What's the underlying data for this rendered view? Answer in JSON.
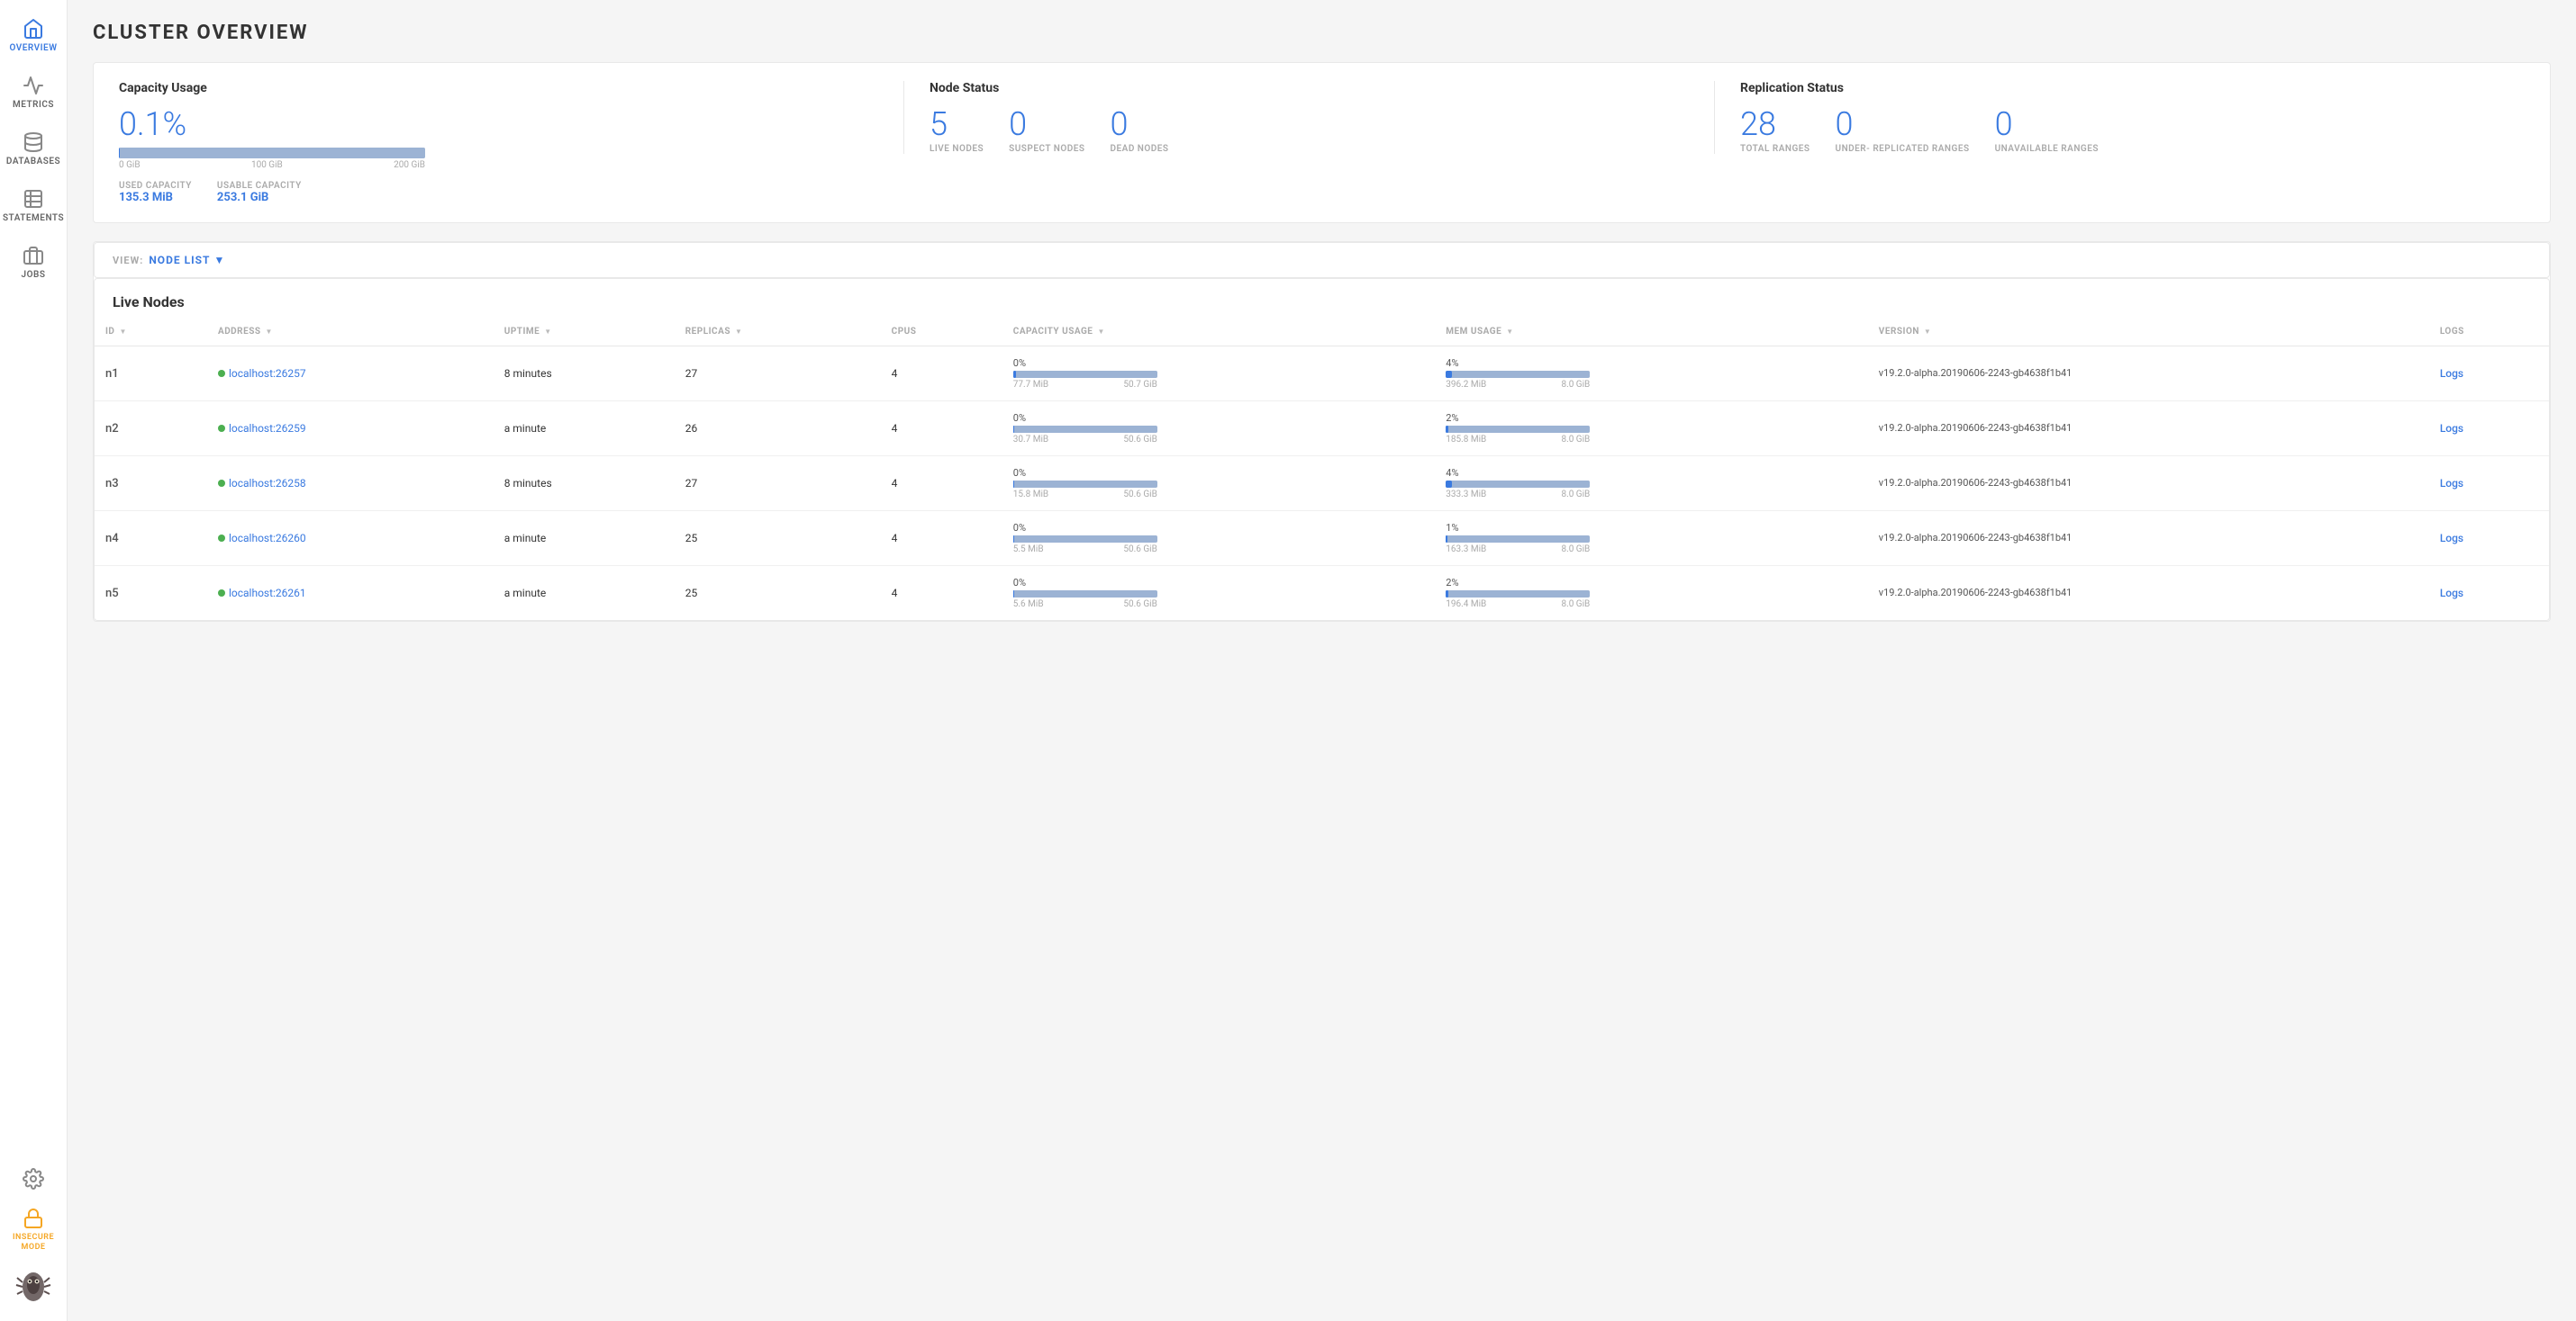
{
  "page": {
    "title": "CLUSTER OVERVIEW"
  },
  "sidebar": {
    "items": [
      {
        "id": "overview",
        "label": "OVERVIEW",
        "active": true
      },
      {
        "id": "metrics",
        "label": "METRICS",
        "active": false
      },
      {
        "id": "databases",
        "label": "DATABASES",
        "active": false
      },
      {
        "id": "statements",
        "label": "STATEMENTS",
        "active": false
      },
      {
        "id": "jobs",
        "label": "JOBS",
        "active": false
      },
      {
        "id": "settings",
        "label": "",
        "active": false
      },
      {
        "id": "insecure",
        "label": "INSECURE MODE",
        "active": false
      }
    ]
  },
  "summary": {
    "capacity_usage": {
      "title": "Capacity Usage",
      "percentage": "0.1%",
      "bar_labels": [
        "0 GiB",
        "100 GiB",
        "200 GiB"
      ],
      "used_label": "USED CAPACITY",
      "used_value": "135.3 MiB",
      "usable_label": "USABLE CAPACITY",
      "usable_value": "253.1 GiB"
    },
    "node_status": {
      "title": "Node Status",
      "live": "5",
      "live_label": "LIVE NODES",
      "suspect": "0",
      "suspect_label": "SUSPECT NODES",
      "dead": "0",
      "dead_label": "DEAD NODES"
    },
    "replication_status": {
      "title": "Replication Status",
      "total": "28",
      "total_label": "TOTAL RANGES",
      "under_replicated": "0",
      "under_replicated_label": "UNDER- REPLICATED RANGES",
      "unavailable": "0",
      "unavailable_label": "UNAVAILABLE RANGES"
    }
  },
  "view": {
    "label": "VIEW:",
    "selected": "NODE LIST"
  },
  "live_nodes": {
    "title": "Live Nodes",
    "columns": {
      "id": "ID",
      "address": "ADDRESS",
      "uptime": "UPTIME",
      "replicas": "REPLICAS",
      "cpus": "CPUS",
      "capacity_usage": "CAPACITY USAGE",
      "mem_usage": "MEM USAGE",
      "version": "VERSION",
      "logs": "LOGS"
    },
    "rows": [
      {
        "id": "n1",
        "address": "localhost:26257",
        "uptime": "8 minutes",
        "replicas": "27",
        "cpus": "4",
        "cap_pct": "0%",
        "cap_used": "77.7 MiB",
        "cap_total": "50.7 GiB",
        "cap_fill_pct": 2,
        "mem_pct": "4%",
        "mem_used": "396.2 MiB",
        "mem_total": "8.0 GiB",
        "mem_fill_pct": 4,
        "version": "v19.2.0-alpha.20190606-2243-gb4638f1b41",
        "logs": "Logs"
      },
      {
        "id": "n2",
        "address": "localhost:26259",
        "uptime": "a minute",
        "replicas": "26",
        "cpus": "4",
        "cap_pct": "0%",
        "cap_used": "30.7 MiB",
        "cap_total": "50.6 GiB",
        "cap_fill_pct": 1,
        "mem_pct": "2%",
        "mem_used": "185.8 MiB",
        "mem_total": "8.0 GiB",
        "mem_fill_pct": 2,
        "version": "v19.2.0-alpha.20190606-2243-gb4638f1b41",
        "logs": "Logs"
      },
      {
        "id": "n3",
        "address": "localhost:26258",
        "uptime": "8 minutes",
        "replicas": "27",
        "cpus": "4",
        "cap_pct": "0%",
        "cap_used": "15.8 MiB",
        "cap_total": "50.6 GiB",
        "cap_fill_pct": 1,
        "mem_pct": "4%",
        "mem_used": "333.3 MiB",
        "mem_total": "8.0 GiB",
        "mem_fill_pct": 4,
        "version": "v19.2.0-alpha.20190606-2243-gb4638f1b41",
        "logs": "Logs"
      },
      {
        "id": "n4",
        "address": "localhost:26260",
        "uptime": "a minute",
        "replicas": "25",
        "cpus": "4",
        "cap_pct": "0%",
        "cap_used": "5.5 MiB",
        "cap_total": "50.6 GiB",
        "cap_fill_pct": 1,
        "mem_pct": "1%",
        "mem_used": "163.3 MiB",
        "mem_total": "8.0 GiB",
        "mem_fill_pct": 1,
        "version": "v19.2.0-alpha.20190606-2243-gb4638f1b41",
        "logs": "Logs"
      },
      {
        "id": "n5",
        "address": "localhost:26261",
        "uptime": "a minute",
        "replicas": "25",
        "cpus": "4",
        "cap_pct": "0%",
        "cap_used": "5.6 MiB",
        "cap_total": "50.6 GiB",
        "cap_fill_pct": 1,
        "mem_pct": "2%",
        "mem_used": "196.4 MiB",
        "mem_total": "8.0 GiB",
        "mem_fill_pct": 2,
        "version": "v19.2.0-alpha.20190606-2243-gb4638f1b41",
        "logs": "Logs"
      }
    ]
  }
}
